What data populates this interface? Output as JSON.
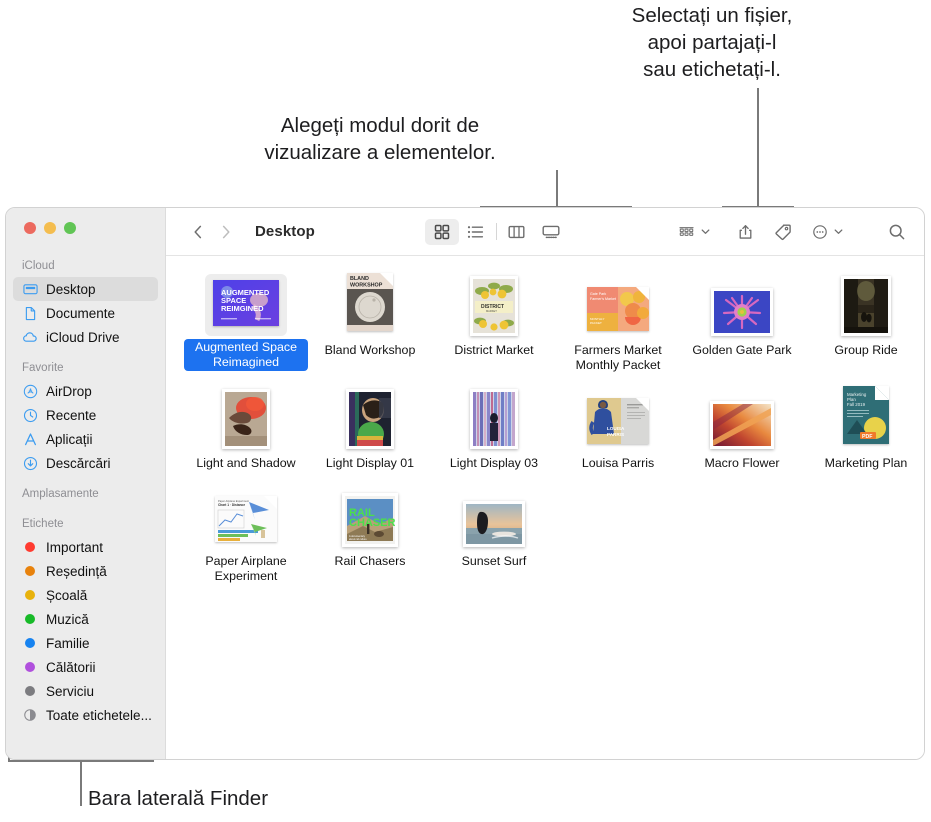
{
  "callouts": {
    "view_modes": "Alegeți modul dorit de\nvizualizare a elementelor.",
    "share_tag": "Selectați un fișier,\napoi partajați-l\nsau etichetați-l.",
    "sidebar": "Bara laterală Finder"
  },
  "window": {
    "traffic_lights": [
      "close",
      "minimize",
      "zoom"
    ],
    "colors": {
      "close": "#ec6a5f",
      "minimize": "#f4bd4f",
      "zoom": "#61c555",
      "selection_blue": "#1d72f0",
      "sidebar_bg": "#ececec"
    }
  },
  "toolbar": {
    "back_label": "‹",
    "forward_label": "›",
    "title": "Desktop",
    "view_modes": [
      {
        "name": "icon-view",
        "label": "Pictograme",
        "active": true
      },
      {
        "name": "list-view",
        "label": "Listă",
        "active": false
      },
      {
        "name": "column-view",
        "label": "Coloane",
        "active": false
      },
      {
        "name": "gallery-view",
        "label": "Galerie",
        "active": false
      }
    ],
    "group_by_label": "Grupare",
    "share_label": "Partajare",
    "tag_label": "Etichete",
    "more_label": "Mai multe",
    "search_label": "Căutare"
  },
  "sidebar": {
    "sections": [
      {
        "header": "iCloud",
        "items": [
          {
            "label": "Desktop",
            "icon": "desktop-icon",
            "selected": true
          },
          {
            "label": "Documente",
            "icon": "document-icon",
            "selected": false
          },
          {
            "label": "iCloud Drive",
            "icon": "cloud-icon",
            "selected": false
          }
        ]
      },
      {
        "header": "Favorite",
        "items": [
          {
            "label": "AirDrop",
            "icon": "airdrop-icon",
            "selected": false
          },
          {
            "label": "Recente",
            "icon": "clock-icon",
            "selected": false
          },
          {
            "label": "Aplicații",
            "icon": "applications-icon",
            "selected": false
          },
          {
            "label": "Descărcări",
            "icon": "downloads-icon",
            "selected": false
          }
        ]
      },
      {
        "header": "Amplasamente",
        "items": []
      },
      {
        "header": "Etichete",
        "items": [
          {
            "label": "Important",
            "icon": "tag-dot",
            "color": "#ff3b30"
          },
          {
            "label": "Reședință",
            "icon": "tag-dot",
            "color": "#e8820c"
          },
          {
            "label": "Școală",
            "icon": "tag-dot",
            "color": "#e8b20c"
          },
          {
            "label": "Muzică",
            "icon": "tag-dot",
            "color": "#17ba28"
          },
          {
            "label": "Familie",
            "icon": "tag-dot",
            "color": "#1783f0"
          },
          {
            "label": "Călătorii",
            "icon": "tag-dot",
            "color": "#b050dd"
          },
          {
            "label": "Serviciu",
            "icon": "tag-dot",
            "color": "#7c7c80"
          },
          {
            "label": "Toate etichetele...",
            "icon": "all-tags-icon",
            "color": ""
          }
        ]
      }
    ]
  },
  "files": [
    {
      "name": "Augmented Space Reimagined",
      "kind": "document",
      "selected": true
    },
    {
      "name": "Bland Workshop",
      "kind": "document",
      "selected": false
    },
    {
      "name": "District Market",
      "kind": "photo",
      "selected": false
    },
    {
      "name": "Farmers Market Monthly Packet",
      "kind": "document",
      "selected": false
    },
    {
      "name": "Golden Gate Park",
      "kind": "photo",
      "selected": false
    },
    {
      "name": "Group Ride",
      "kind": "photo",
      "selected": false
    },
    {
      "name": "Light and Shadow",
      "kind": "photo",
      "selected": false
    },
    {
      "name": "Light Display 01",
      "kind": "photo",
      "selected": false
    },
    {
      "name": "Light Display 03",
      "kind": "photo",
      "selected": false
    },
    {
      "name": "Louisa Parris",
      "kind": "document",
      "selected": false
    },
    {
      "name": "Macro Flower",
      "kind": "photo",
      "selected": false
    },
    {
      "name": "Marketing Plan",
      "kind": "pdf",
      "selected": false
    },
    {
      "name": "Paper Airplane Experiment",
      "kind": "document",
      "selected": false
    },
    {
      "name": "Rail Chasers",
      "kind": "photo",
      "selected": false
    },
    {
      "name": "Sunset Surf",
      "kind": "photo",
      "selected": false
    }
  ]
}
